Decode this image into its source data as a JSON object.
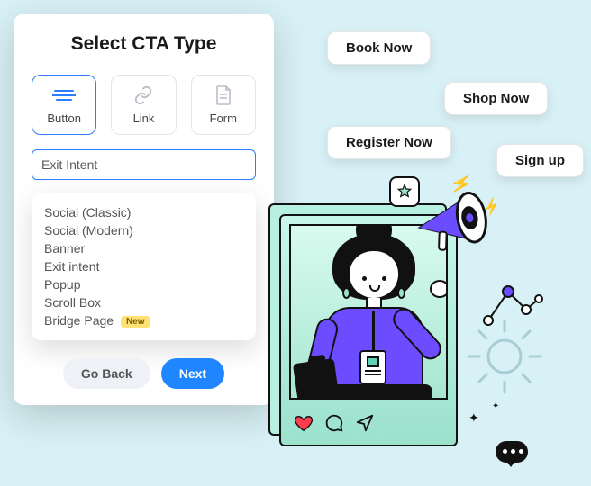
{
  "panel": {
    "title": "Select CTA Type",
    "types": [
      {
        "label": "Button",
        "selected": true
      },
      {
        "label": "Link",
        "selected": false
      },
      {
        "label": "Form",
        "selected": false
      }
    ],
    "input_value": "Exit Intent",
    "options": [
      "Social (Classic)",
      "Social (Modern)",
      "Banner",
      "Exit intent",
      "Popup",
      "Scroll Box",
      "Bridge Page"
    ],
    "new_badge": "New",
    "go_back": "Go Back",
    "next": "Next"
  },
  "pills": {
    "book_now": "Book Now",
    "shop_now": "Shop Now",
    "register_now": "Register Now",
    "sign_up": "Sign up"
  }
}
